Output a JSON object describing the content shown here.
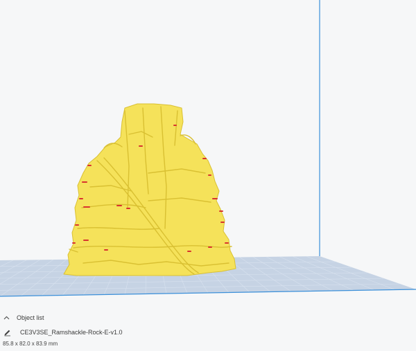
{
  "viewport": {
    "background_color": "#f6f7f8",
    "build_plate_color": "#c6d3e4",
    "grid_line_color": "#d8e2ef",
    "build_volume_edge_color": "#3a8fd9",
    "model_color": "#f5e25a",
    "model_shadow_color": "#d9c032",
    "overhang_color": "#d8322e"
  },
  "object_panel": {
    "toggle_icon": "chevron-up-icon",
    "toggle_label": "Object list",
    "edit_icon": "pencil-icon",
    "object_name": "CE3V3SE_Ramshackle-Rock-E-v1.0",
    "dimensions": "85.8 x 82.0 x 83.9 mm"
  }
}
